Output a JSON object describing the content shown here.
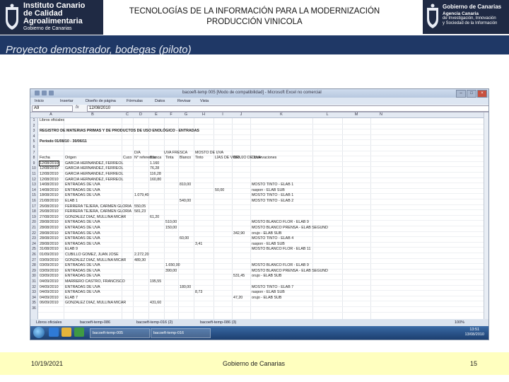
{
  "header": {
    "left_logo": {
      "line1": "Instituto Canario",
      "line2": "de Calidad",
      "line3": "Agroalimentaria",
      "line4": "Gobierno de Canarias"
    },
    "title_line1": "TECNOLOGÍAS DE LA INFORMACIÓN PARA LA MODERNIZACIÓN",
    "title_line2": "PRODUCCIÓN VINICOLA",
    "right_logo": {
      "line1": "Gobierno de Canarias",
      "line2": "Agencia Canaria",
      "line3": "de Investigación, Innovación",
      "line4": "y Sociedad de la Información",
      "line5": ""
    }
  },
  "banner": {
    "text": "Proyecto demostrador, bodegas (piloto)"
  },
  "screenshot": {
    "window_title": "bacoeft-temp 005 [Modo de compatibilidad] - Microsoft Excel no comercial",
    "ribbon_tabs": [
      "Inicio",
      "Insertar",
      "Diseño de página",
      "Fórmulas",
      "Datos",
      "Revisar",
      "Vista"
    ],
    "name_box": "A9",
    "fx": "fx",
    "formula_value": "12/08/2010",
    "column_letters": [
      "A",
      "B",
      "C",
      "D",
      "E",
      "F",
      "G",
      "H",
      "I",
      "J",
      "K",
      "L",
      "M",
      "N"
    ],
    "row_numbers": [
      "1",
      "2",
      "3",
      "4",
      "5",
      "6",
      "7",
      "8",
      "9",
      "10",
      "11",
      "12",
      "13",
      "14",
      "15",
      "16",
      "17",
      "18",
      "19",
      "20",
      "21",
      "22",
      "23",
      "24",
      "25",
      "26",
      "27",
      "28",
      "29",
      "30",
      "31",
      "32",
      "33",
      "34",
      "35",
      "36"
    ],
    "sheet": {
      "r1": "Libros oficiales",
      "r3": "REGISTRO DE MATERIAS PRIMAS Y DE PRODUCTOS DE USO ENOLÓGICO - ENTRADAS",
      "r5": "Período 01/08/10 - 30/06/11",
      "group_headers": [
        "D/A",
        "UVA FRESCA",
        "MOSTO DE UVA"
      ],
      "headers": [
        "Fecha",
        "Origen",
        "Cuco",
        "N° referencia",
        "Blanca",
        "Tinta",
        "Blanco",
        "Tinto",
        "LÍAS DE VINO",
        "ORUJO DE UVA",
        "Observaciones"
      ],
      "rows": [
        [
          "12/08/2010",
          "GARCIA HERNANDEZ, FERREOL",
          "",
          "1.160",
          "",
          "",
          "",
          "",
          "",
          ""
        ],
        [
          "12/08/2010",
          "GARCIA HERNANDEZ, FERREOL",
          "",
          "76,28",
          "",
          "",
          "",
          "",
          "",
          ""
        ],
        [
          "12/08/2010",
          "GARCIA HERNANDEZ, FERREOL",
          "",
          "116,28",
          "",
          "",
          "",
          "",
          "",
          ""
        ],
        [
          "12/08/2010",
          "GARCIA HERNANDEZ, FERREOL",
          "",
          "160,80",
          "",
          "",
          "",
          "",
          "",
          ""
        ],
        [
          "14/08/2010",
          "ENTRADAS DE UVA",
          "",
          "",
          "",
          "810,00",
          "",
          "",
          "",
          "MOSTO TINTO - ELAB 1"
        ],
        [
          "14/08/2010",
          "ENTRADAS DE UVA",
          "",
          "",
          "",
          "",
          "",
          "50,00",
          "",
          "raspon - ELAB SUB"
        ],
        [
          "18/08/2010",
          "ENTRADAS DE UVA",
          "1.079,40",
          "",
          "",
          "",
          "",
          "",
          "",
          "MOSTO TINTO - ELAB 1"
        ],
        [
          "21/08/2010",
          "ELAB 1",
          "",
          "",
          "",
          "540,00",
          "",
          "",
          "",
          "MOSTO TINTO - ELAB 2"
        ],
        [
          "26/08/2010",
          "FERRERA TEJERA, CARMEN GLORIA",
          "550,05",
          "",
          "",
          "",
          "",
          "",
          "",
          ""
        ],
        [
          "26/08/2010",
          "FERRERA TEJERA, CARMEN GLORIA",
          "581,23",
          "",
          "",
          "",
          "",
          "",
          "",
          ""
        ],
        [
          "27/08/2010",
          "GONZALEZ DIAZ, MULLINA MICAR",
          "",
          "61,20",
          "",
          "",
          "",
          "",
          "",
          ""
        ],
        [
          "28/08/2010",
          "ENTRADAS DE UVA",
          "",
          "",
          "510,00",
          "",
          "",
          "",
          "",
          "MOSTO BLANCO FLOR - ELAB 9"
        ],
        [
          "28/08/2010",
          "ENTRADAS DE UVA",
          "",
          "",
          "150,00",
          "",
          "",
          "",
          "",
          "MOSTO BLANCO PRENSA - ELAB SEGUND"
        ],
        [
          "28/08/2010",
          "ENTRADAS DE UVA",
          "",
          "",
          "",
          "",
          "",
          "",
          "342,90",
          "orujo - ELAB SUB"
        ],
        [
          "28/08/2010",
          "ENTRADAS DE UVA",
          "",
          "",
          "",
          "60,00",
          "",
          "",
          "",
          "MOSTO TINTO - ELAB 4"
        ],
        [
          "28/08/2010",
          "ENTRADAS DE UVA",
          "",
          "",
          "",
          "",
          "3,41",
          "",
          "",
          "raspon - ELAB SUB"
        ],
        [
          "31/08/2010",
          "ELAB 9",
          "",
          "",
          "",
          "",
          "",
          "",
          "",
          "MOSTO BLANCO FLOR - ELAB 11"
        ],
        [
          "01/09/2010",
          "CUBILLO GOMEZ, JUAN JOSE",
          "2.272,20",
          "",
          "",
          "",
          "",
          "",
          "",
          ""
        ],
        [
          "03/09/2010",
          "GONZALEZ DIAZ, MULLINA MICAR",
          "489,30",
          "",
          "",
          "",
          "",
          "",
          "",
          ""
        ],
        [
          "03/09/2010",
          "ENTRADAS DE UVA",
          "",
          "",
          "1.650,00",
          "",
          "",
          "",
          "",
          "MOSTO BLANCO FLOR - ELAB 9"
        ],
        [
          "03/09/2010",
          "ENTRADAS DE UVA",
          "",
          "",
          "390,00",
          "",
          "",
          "",
          "",
          "MOSTO BLANCO PRENSA - ELAB SEGUND"
        ],
        [
          "03/09/2010",
          "ENTRADAS DE UVA",
          "",
          "",
          "",
          "",
          "",
          "",
          "531,45",
          "orujo - ELAB SUB"
        ],
        [
          "04/09/2010",
          "MARRERO CASTRO, FRANCISCO",
          "",
          "195,55",
          "",
          "",
          "",
          "",
          "",
          ""
        ],
        [
          "04/09/2010",
          "ENTRADAS DE UVA",
          "",
          "",
          "",
          "180,00",
          "",
          "",
          "",
          "MOSTO TINTO - ELAB 7"
        ],
        [
          "04/09/2010",
          "ENTRADAS DE UVA",
          "",
          "",
          "",
          "",
          "8,73",
          "",
          "",
          "raspon - ELAB SUB"
        ],
        [
          "04/09/2010",
          "ELAB 7",
          "",
          "",
          "",
          "",
          "",
          "",
          "47,20",
          "orujo - ELAB SUB"
        ],
        [
          "06/09/2010",
          "GONZALEZ DIAZ, MULLINA MICAR",
          "",
          "431,60",
          "",
          "",
          "",
          "",
          "",
          ""
        ]
      ]
    },
    "sheet_tabs": [
      "Libros oficiales",
      "bacoeft-temp-086",
      "bacoeft-temp-016 (2)",
      "bacoeft-temp-086 (3)"
    ],
    "zoom": "100%",
    "taskbar_items": [
      "bacoeft-temp-005",
      "bacoeft-temp-016"
    ],
    "clock_time": "13:51",
    "clock_date": "13/08/2010"
  },
  "footer": {
    "date": "10/19/2021",
    "org": "Gobierno de Canarias",
    "page": "15"
  }
}
